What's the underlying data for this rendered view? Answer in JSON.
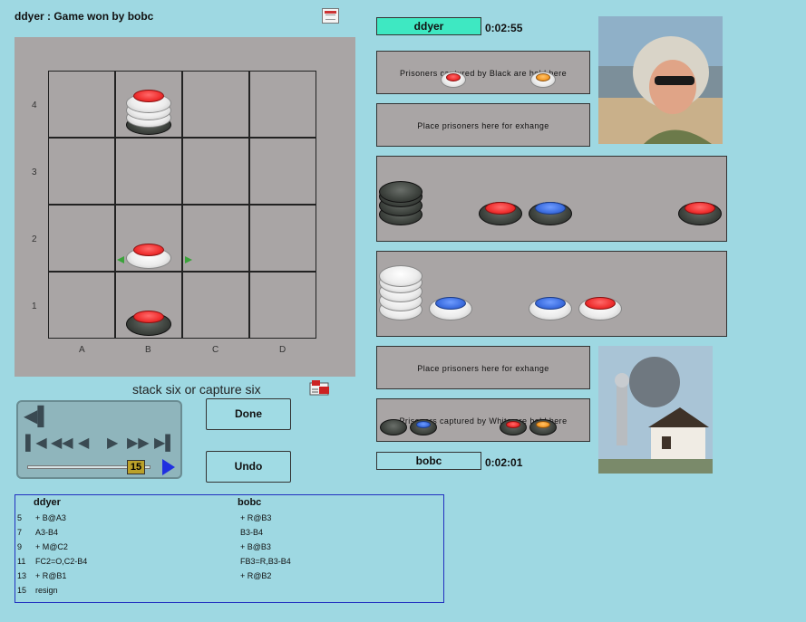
{
  "header": {
    "title": "ddyer : Game won by bobc"
  },
  "board": {
    "row_labels": [
      "4",
      "3",
      "2",
      "1"
    ],
    "col_labels": [
      "A",
      "B",
      "C",
      "D"
    ]
  },
  "status_text": "stack six or capture six",
  "rules_icon": "rules-icon",
  "players": {
    "top": {
      "name": "ddyer",
      "clock": "0:02:55",
      "bar_color": "#3ee8c2"
    },
    "bottom": {
      "name": "bobc",
      "clock": "0:02:01",
      "bar_color": "#a0dbe4"
    }
  },
  "prisoner_boxes": {
    "black_captured": "Prisoners captured by Black are held here",
    "exchange_top": "Place prisoners here for exhange",
    "exchange_bottom": "Place prisoners here for exhange",
    "white_captured": "Prisoners captured by White are held here"
  },
  "controls": {
    "move_number": "15",
    "done_label": "Done",
    "undo_label": "Undo"
  },
  "move_log": {
    "col_a": "ddyer",
    "col_b": "bobc",
    "rows": [
      {
        "num": "5",
        "a": "+ B@A3",
        "b": "+ R@B3"
      },
      {
        "num": "7",
        "a": "A3-B4",
        "b": "B3-B4"
      },
      {
        "num": "9",
        "a": "+ M@C2",
        "b": "+ B@B3"
      },
      {
        "num": "11",
        "a": "FC2=O,C2-B4",
        "b": "FB3=R,B3-B4"
      },
      {
        "num": "13",
        "a": "+ R@B1",
        "b": "+ R@B2"
      },
      {
        "num": "15",
        "a": "resign",
        "b": ""
      }
    ]
  },
  "colors": {
    "background": "#9ed8e2",
    "panel": "#a9a5a5",
    "red": "#ef2f2f",
    "blue": "#3d6ee0",
    "orange": "#f59c2a"
  }
}
